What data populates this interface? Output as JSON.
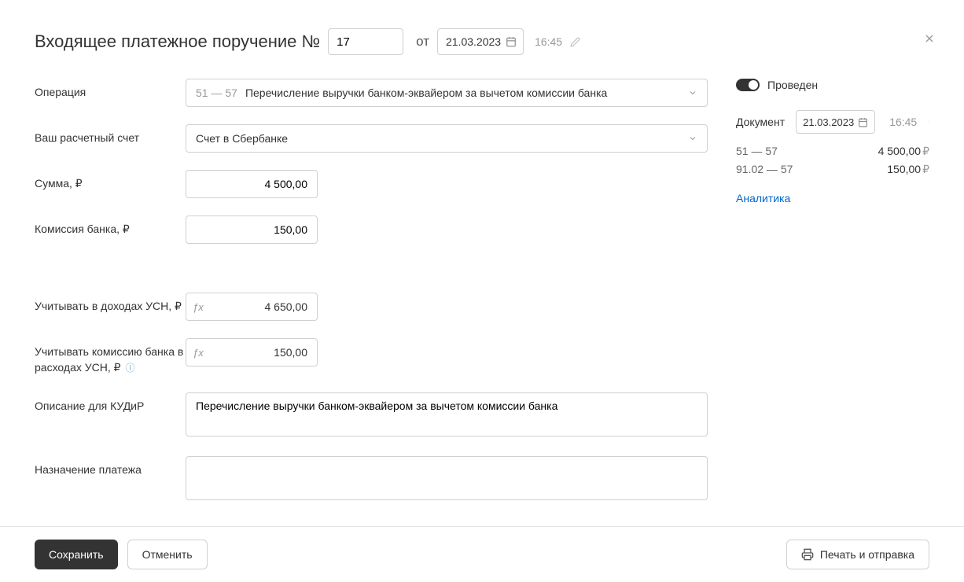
{
  "header": {
    "title": "Входящее платежное поручение №",
    "number": "17",
    "from_label": "от",
    "date": "21.03.2023",
    "time": "16:45"
  },
  "form": {
    "operation": {
      "label": "Операция",
      "code": "51 — 57",
      "text": "Перечисление выручки банком-эквайером за вычетом комиссии банка"
    },
    "account": {
      "label": "Ваш расчетный счет",
      "value": "Счет в Сбербанке"
    },
    "amount": {
      "label": "Сумма, ₽",
      "value": "4 500,00"
    },
    "commission": {
      "label": "Комиссия банка, ₽",
      "value": "150,00"
    },
    "usn_income": {
      "label": "Учитывать в доходах УСН, ₽",
      "value": "4 650,00"
    },
    "usn_expense": {
      "label": "Учитывать комиссию банка в расходах УСН, ₽",
      "value": "150,00"
    },
    "kudir": {
      "label": "Описание для КУДиР",
      "value": "Перечисление выручки банком-эквайером за вычетом комиссии банка"
    },
    "purpose": {
      "label": "Назначение платежа",
      "value": ""
    }
  },
  "side": {
    "posted_label": "Проведен",
    "doc_label": "Документ",
    "doc_date": "21.03.2023",
    "doc_time": "16:45",
    "entries": [
      {
        "code": "51 — 57",
        "amount": "4 500,00"
      },
      {
        "code": "91.02 — 57",
        "amount": "150,00"
      }
    ],
    "analytics": "Аналитика"
  },
  "footer": {
    "save": "Сохранить",
    "cancel": "Отменить",
    "print": "Печать и отправка"
  },
  "currency": "₽",
  "fx": "ƒx"
}
